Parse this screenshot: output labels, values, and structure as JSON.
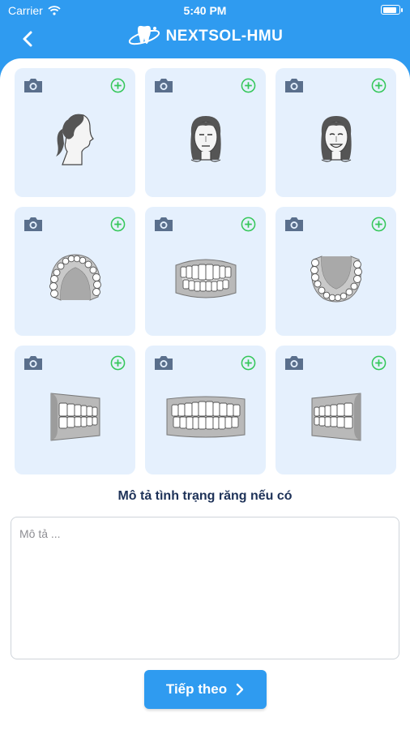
{
  "status_bar": {
    "carrier": "Carrier",
    "time": "5:40 PM",
    "battery_level": 0.9
  },
  "header": {
    "title": "NEXTSOL-HMU",
    "back_icon": "chevron-left-icon",
    "logo_icon": "tooth-logo-icon"
  },
  "photo_slots": [
    {
      "name": "profile-photo",
      "illustration": "face-profile"
    },
    {
      "name": "frontal-photo",
      "illustration": "face-front"
    },
    {
      "name": "smile-photo",
      "illustration": "face-smile"
    },
    {
      "name": "upper-arch-photo",
      "illustration": "upper-arch"
    },
    {
      "name": "front-teeth-photo",
      "illustration": "front-teeth"
    },
    {
      "name": "lower-arch-photo",
      "illustration": "lower-arch"
    },
    {
      "name": "right-bite-photo",
      "illustration": "right-bite"
    },
    {
      "name": "front-bite-photo",
      "illustration": "front-bite"
    },
    {
      "name": "left-bite-photo",
      "illustration": "left-bite"
    }
  ],
  "description": {
    "label": "Mô tả tình trạng răng nếu có",
    "placeholder": "Mô tả ...",
    "value": ""
  },
  "next_button": {
    "label": "Tiếp theo"
  },
  "colors": {
    "primary": "#2f9bf0",
    "card_bg": "#e5f0fd",
    "add_green": "#34c759",
    "camera_gray": "#5a6f8c",
    "label_text": "#1e3258"
  }
}
